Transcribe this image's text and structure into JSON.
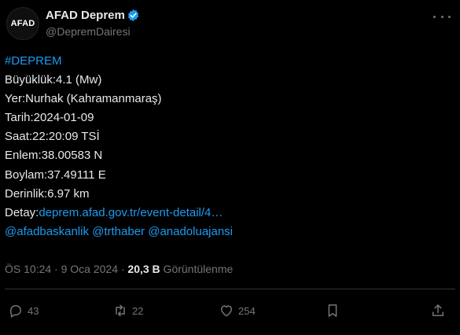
{
  "author": {
    "avatar_text": "AFAD",
    "display_name": "AFAD Deprem",
    "handle": "@DepremDairesi"
  },
  "tweet": {
    "hashtag": "#DEPREM",
    "lines": [
      "Büyüklük:4.1 (Mw)",
      "Yer:Nurhak (Kahramanmaraş)",
      "Tarih:2024-01-09",
      "Saat:22:20:09 TSİ",
      "Enlem:38.00583 N",
      "Boylam:37.49111 E",
      "Derinlik:6.97 km"
    ],
    "detail_label": "Detay:",
    "detail_link": "deprem.afad.gov.tr/event-detail/4…",
    "mentions": "@afadbaskanlik @trthaber @anadoluajansi"
  },
  "meta": {
    "time_date": "ÖS 10:24 · 9 Oca 2024 · ",
    "views_count": "20,3 B",
    "views_label": " Görüntülenme"
  },
  "actions": {
    "replies": "43",
    "reposts": "22",
    "likes": "254"
  },
  "colors": {
    "background": "#000000",
    "text": "#e7e9ea",
    "muted": "#71767b",
    "link": "#1d9bf0"
  }
}
